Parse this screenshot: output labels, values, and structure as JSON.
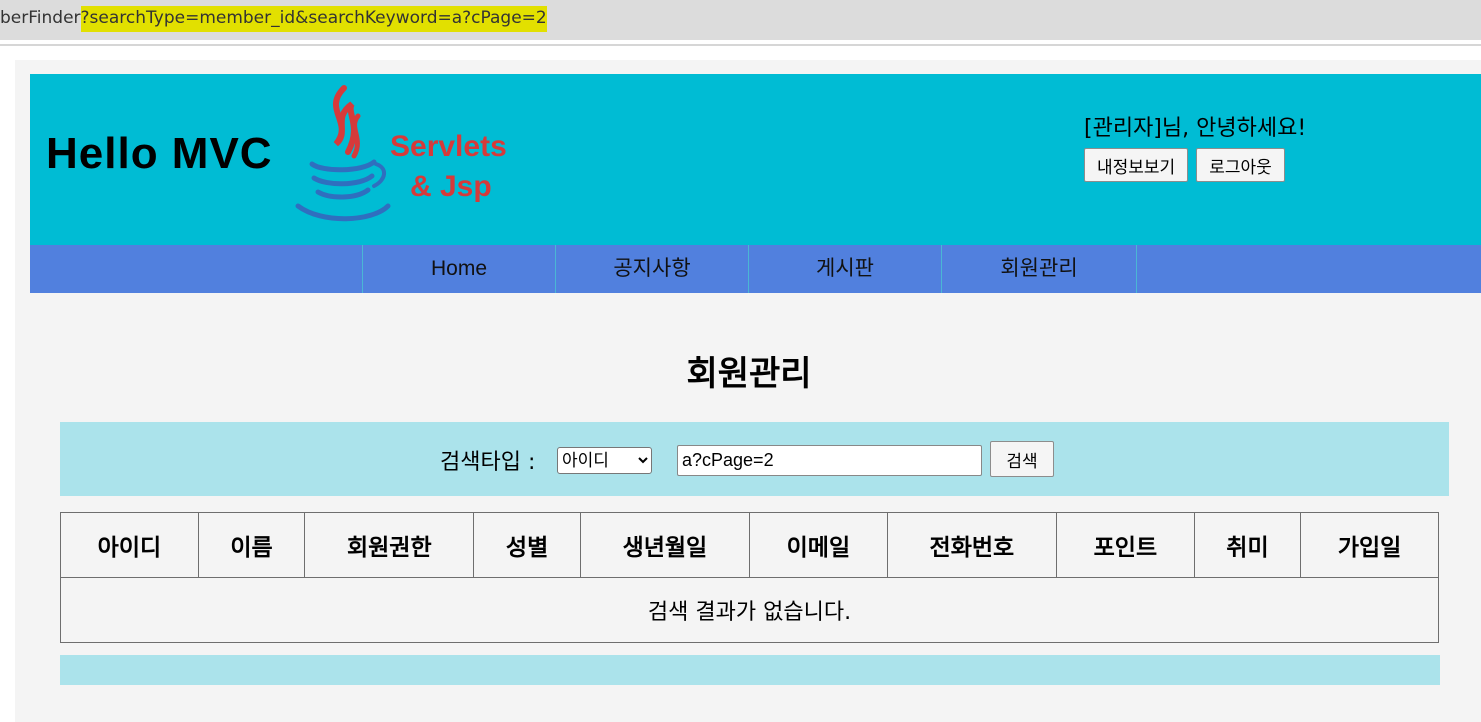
{
  "browser": {
    "url_prefix": "berFinder",
    "url_query": "?searchType=member_id&searchKeyword=a?cPage=2"
  },
  "header": {
    "site_title": "Hello MVC",
    "logo_line1": "Servlets",
    "logo_line2": "& Jsp",
    "greeting": "[관리자]님, 안녕하세요!",
    "my_info_button": "내정보보기",
    "logout_button": "로그아웃"
  },
  "nav": {
    "items": [
      "Home",
      "공지사항",
      "게시판",
      "회원관리"
    ]
  },
  "main": {
    "page_title": "회원관리",
    "search": {
      "label": "검색타입 :",
      "selected_type": "아이디",
      "keyword_value": "a?cPage=2",
      "button": "검색"
    },
    "table": {
      "headers": [
        "아이디",
        "이름",
        "회원권한",
        "성별",
        "생년월일",
        "이메일",
        "전화번호",
        "포인트",
        "취미",
        "가입일"
      ],
      "empty_message": "검색 결과가 없습니다."
    }
  },
  "colors": {
    "header_bg": "#00bcd4",
    "nav_bg": "#5180de",
    "search_bg": "#abe3eb",
    "url_highlight": "#e2e000",
    "logo_red": "#d63a3a",
    "logo_blue": "#2f6fbf"
  }
}
